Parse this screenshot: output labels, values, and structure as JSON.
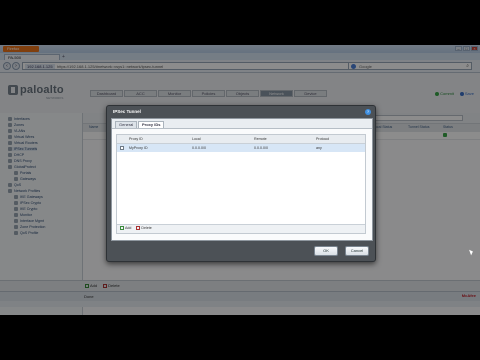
{
  "browser": {
    "app_menu_label": "Firefox",
    "tab_title": "PA-500",
    "new_tab_glyph": "+",
    "url_host": "192.168.1.125",
    "url_path": "https://192.168.1.125/#network::vsys1::network/ipsec-tunnel",
    "search_placeholder": "Google"
  },
  "app": {
    "logo_text": "paloalto",
    "logo_sub": "NETWORKS",
    "tabs": [
      "Dashboard",
      "ACC",
      "Monitor",
      "Policies",
      "Objects",
      "Network",
      "Device"
    ],
    "active_tab": "Network",
    "header_actions": [
      "Commit",
      "Save"
    ]
  },
  "sidebar": {
    "items": [
      {
        "label": "Interfaces"
      },
      {
        "label": "Zones"
      },
      {
        "label": "VLANs"
      },
      {
        "label": "Virtual Wires"
      },
      {
        "label": "Virtual Routers"
      },
      {
        "label": "IPSec Tunnels"
      },
      {
        "label": "DHCP"
      },
      {
        "label": "DNS Proxy"
      },
      {
        "label": "GlobalProtect"
      },
      {
        "label": "Portals"
      },
      {
        "label": "Gateways"
      },
      {
        "label": "QoS"
      },
      {
        "label": "Network Profiles"
      },
      {
        "label": "IKE Gateways"
      },
      {
        "label": "IPSec Crypto"
      },
      {
        "label": "IKE Crypto"
      },
      {
        "label": "Monitor"
      },
      {
        "label": "Interface Mgmt"
      },
      {
        "label": "Zone Protection"
      },
      {
        "label": "QoS Profile"
      }
    ]
  },
  "main": {
    "columns": [
      "Name",
      "Local Status",
      "Tunnel Status",
      "Status"
    ],
    "footer_actions": [
      "Add",
      "Delete"
    ]
  },
  "statusbar": {
    "left": "Done",
    "right_brand": "McAfee"
  },
  "modal": {
    "title": "IPSec Tunnel",
    "tabs": [
      "General",
      "Proxy IDs"
    ],
    "active_tab": "Proxy IDs",
    "grid_columns": [
      "Proxy ID",
      "Local",
      "Remote",
      "Protocol"
    ],
    "rows": [
      {
        "proxy_id": "MyProxy ID",
        "local": "0.0.0.0/0",
        "remote": "0.0.0.0/0",
        "protocol": "any"
      }
    ],
    "grid_actions": [
      "Add",
      "Delete"
    ],
    "ok_label": "OK",
    "cancel_label": "Cancel"
  },
  "colors": {
    "modal_bg": "#4c5156",
    "active_app_tab": "#8896a5",
    "selected_row": "#d7e6f6",
    "firefox_orange": "#e9741b"
  }
}
